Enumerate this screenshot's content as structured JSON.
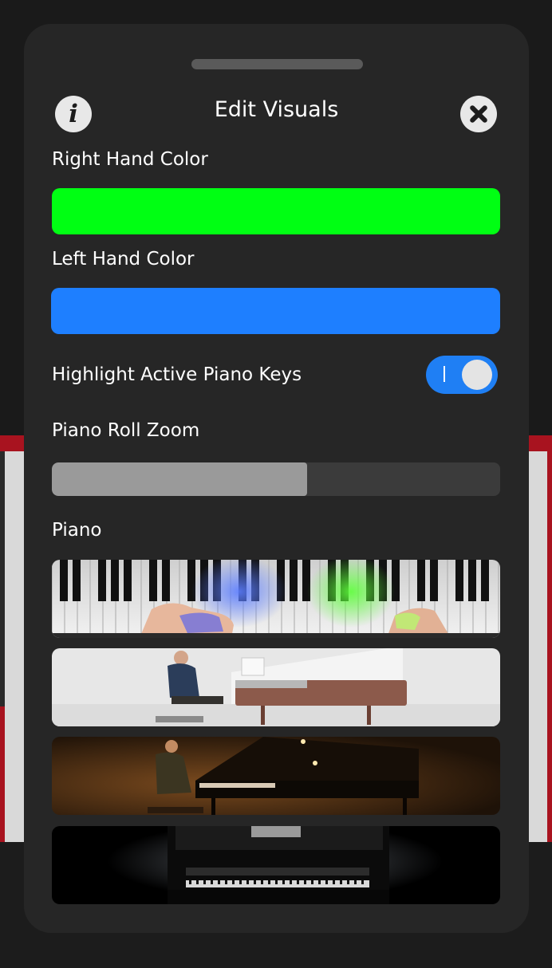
{
  "modal": {
    "title": "Edit Visuals",
    "info_icon": "info-icon",
    "close_icon": "close-icon"
  },
  "settings": {
    "right_hand": {
      "label": "Right Hand Color",
      "color": "#00ff13"
    },
    "left_hand": {
      "label": "Left Hand Color",
      "color": "#1e7fff"
    },
    "highlight_keys": {
      "label": "Highlight Active Piano Keys",
      "enabled": true,
      "accent": "#1f7ff4"
    },
    "zoom": {
      "label": "Piano Roll Zoom",
      "value_fraction": 0.57
    },
    "piano": {
      "label": "Piano",
      "options": [
        "keyboard-closeup-thumbnail",
        "white-studio-grand-thumbnail",
        "concert-hall-grand-thumbnail",
        "upright-dark-thumbnail"
      ]
    }
  }
}
